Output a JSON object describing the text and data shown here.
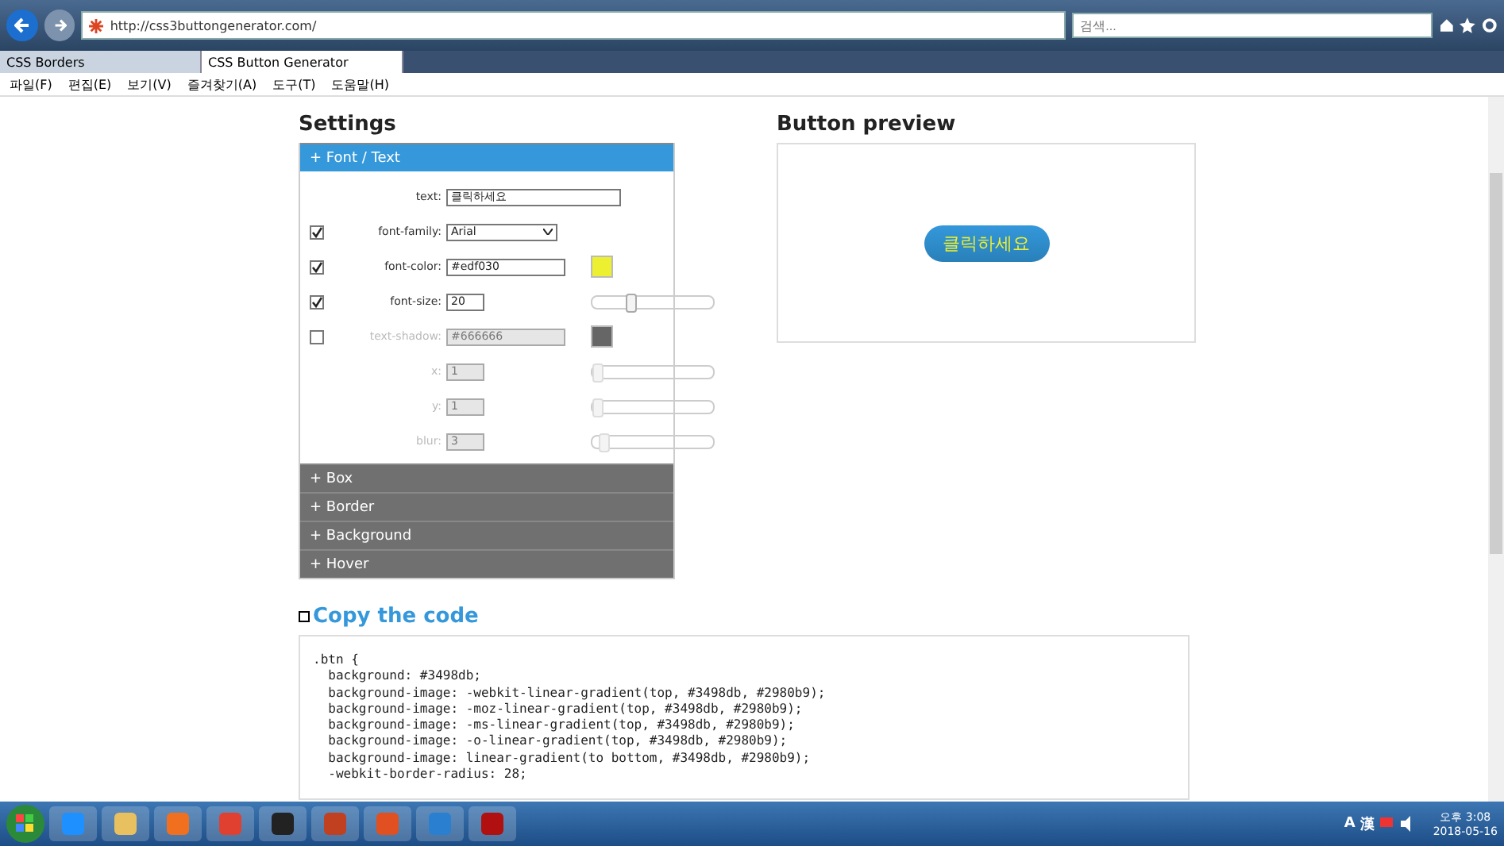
{
  "browser": {
    "url": "http://css3buttongenerator.com/",
    "search": {
      "placeholder": "검색..."
    },
    "tabs": [
      {
        "label": "CSS Borders",
        "selected": false
      },
      {
        "label": "CSS Button Generator",
        "selected": true
      }
    ],
    "menu": [
      "파일(F)",
      "편집(E)",
      "보기(V)",
      "즐겨찾기(A)",
      "도구(T)",
      "도움말(H)"
    ]
  },
  "settings": {
    "title": "Settings",
    "sections": [
      {
        "label": "+ Font / Text",
        "expanded": true,
        "rows": [
          {
            "kind": "text",
            "label": "text:",
            "value": "클릭하세요"
          },
          {
            "kind": "select",
            "label": "font-family:",
            "checked": true,
            "disabled": false,
            "value": "Arial"
          },
          {
            "kind": "color",
            "label": "font-color:",
            "checked": true,
            "disabled": false,
            "value": "#edf030",
            "color": "#edf030"
          },
          {
            "kind": "slider",
            "label": "font-size:",
            "checked": true,
            "disabled": false,
            "value": "20",
            "level": 0.3
          },
          {
            "kind": "color",
            "label": "text-shadow:",
            "checked": false,
            "disabled": true,
            "value": "#666666",
            "color": "#666666"
          },
          {
            "kind": "slider",
            "label": "x:",
            "disabled": true,
            "value": "1",
            "level": 0.0
          },
          {
            "kind": "slider",
            "label": "y:",
            "disabled": true,
            "value": "1",
            "level": 0.0
          },
          {
            "kind": "slider",
            "label": "blur:",
            "disabled": true,
            "value": "3",
            "level": 0.05
          }
        ]
      },
      {
        "label": "+ Box",
        "expanded": false
      },
      {
        "label": "+ Border",
        "expanded": false
      },
      {
        "label": "+ Background",
        "expanded": false
      },
      {
        "label": "+ Hover",
        "expanded": false
      }
    ]
  },
  "preview": {
    "title": "Button preview",
    "button": "클릭하세요"
  },
  "code": {
    "title": "Copy the code",
    "lines": [
      ".btn {",
      "  background: #3498db;",
      "  background-image: -webkit-linear-gradient(top, #3498db, #2980b9);",
      "  background-image: -moz-linear-gradient(top, #3498db, #2980b9);",
      "  background-image: -ms-linear-gradient(top, #3498db, #2980b9);",
      "  background-image: -o-linear-gradient(top, #3498db, #2980b9);",
      "  background-image: linear-gradient(to bottom, #3498db, #2980b9);",
      "  -webkit-border-radius: 28;"
    ]
  },
  "taskbar": {
    "clock_time": "오후 3:08",
    "clock_date": "2018-05-16",
    "tray": [
      "A",
      "漢"
    ]
  }
}
